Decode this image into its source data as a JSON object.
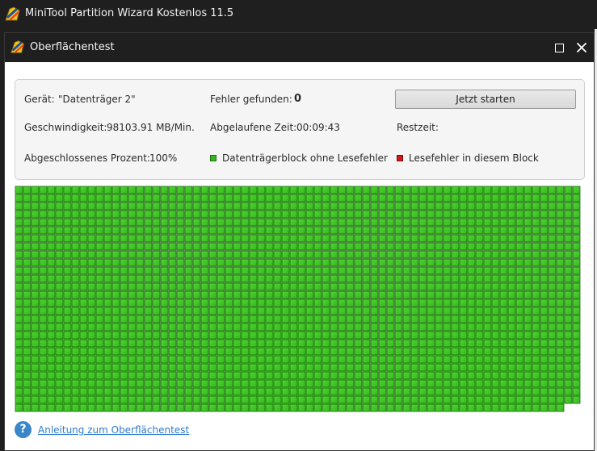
{
  "app": {
    "title": "MiniTool Partition Wizard Kostenlos 11.5"
  },
  "dialog": {
    "title": "Oberflächentest"
  },
  "info": {
    "device_label": "Gerät:",
    "device_value": "\"Datenträger 2\"",
    "errors_label": "Fehler gefunden:",
    "errors_value": "0",
    "start_button": "Jetzt starten",
    "speed_label": "Geschwindigkeit:",
    "speed_value": "98103.91 MB/Min.",
    "elapsed_label": "Abgelaufene Zeit:",
    "elapsed_value": "00:09:43",
    "remaining_label": "Restzeit:",
    "remaining_value": "",
    "percent_label": "Abgeschlossenes Prozent:",
    "percent_value": "100%"
  },
  "legend": {
    "ok_label": "Datenträgerblock ohne Lesefehler",
    "error_label": "Lesefehler in diesem Block",
    "ok_color": "#33b81c",
    "error_color": "#d01818"
  },
  "block_grid": {
    "columns": 70,
    "rows": 28,
    "scanned_blocks": 1958,
    "error_blocks": 0
  },
  "footer": {
    "help_icon": "question-icon",
    "help_link": "Anleitung zum Oberflächentest"
  }
}
